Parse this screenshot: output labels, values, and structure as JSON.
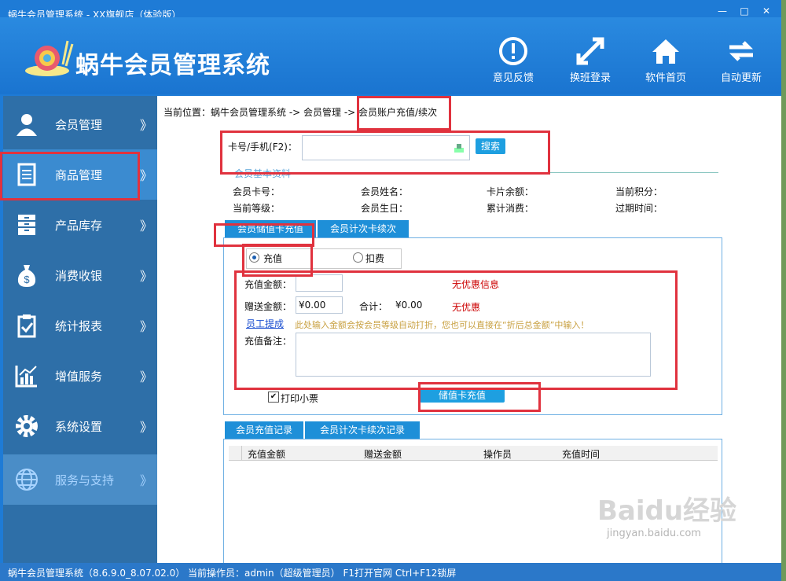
{
  "window": {
    "title": "蜗牛会员管理系统 - XX旗舰店（体验版）",
    "controls": [
      "—",
      "□",
      "✕"
    ]
  },
  "header": {
    "app_title": "蜗牛会员管理系统",
    "buttons": [
      {
        "label": "意见反馈",
        "icon": "exclamation-circle-icon"
      },
      {
        "label": "换班登录",
        "icon": "expand-arrows-icon"
      },
      {
        "label": "软件首页",
        "icon": "home-icon"
      },
      {
        "label": "自动更新",
        "icon": "refresh-arrows-icon"
      }
    ]
  },
  "sidebar": {
    "items": [
      {
        "label": "会员管理",
        "icon": "user-icon",
        "chevron": "》"
      },
      {
        "label": "商品管理",
        "icon": "document-icon",
        "chevron": "》"
      },
      {
        "label": "产品库存",
        "icon": "cabinet-icon",
        "chevron": "》"
      },
      {
        "label": "消费收银",
        "icon": "money-bag-icon",
        "chevron": "》"
      },
      {
        "label": "统计报表",
        "icon": "clipboard-check-icon",
        "chevron": "》"
      },
      {
        "label": "增值服务",
        "icon": "bar-chart-icon",
        "chevron": "》"
      },
      {
        "label": "系统设置",
        "icon": "gear-icon",
        "chevron": "》"
      },
      {
        "label": "服务与支持",
        "icon": "globe-icon",
        "chevron": "》"
      }
    ]
  },
  "content": {
    "breadcrumb_prefix": "当前位置：蜗牛会员管理系统 -> 会员管理 ->",
    "breadcrumb_current": "会员账户充值/续次",
    "search": {
      "label": "卡号/手机(F2)：",
      "value": "",
      "button": "搜索"
    },
    "member_info_title": "会员基本资料",
    "member_info": {
      "card_no": "会员卡号：",
      "name": "会员姓名：",
      "balance": "卡片余额：",
      "points": "当前积分：",
      "level": "当前等级：",
      "birthday": "会员生日：",
      "total_spend": "累计消费：",
      "expire": "过期时间："
    },
    "tabs": [
      "会员储值卡充值",
      "会员计次卡续次"
    ],
    "mode": {
      "recharge": "充值",
      "deduct": "扣费"
    },
    "form": {
      "amount_label": "充值金额：",
      "amount_value": "",
      "discount_info": "无优惠信息",
      "bonus_label": "赠送金额：",
      "bonus_value": "¥0.00",
      "total_label": "合计：",
      "total_value": "¥0.00",
      "no_discount": "无优惠",
      "staff_link": "员工提成",
      "hint": "此处输入金额会按会员等级自动打折，您也可以直接在“折后总金额”中输入！",
      "note_label": "充值备注：",
      "note_value": ""
    },
    "print_receipt": "打印小票",
    "submit_button": "储值卡充值",
    "record_tabs": [
      "会员充值记录",
      "会员计次卡续次记录"
    ],
    "record_columns": [
      "充值金额",
      "赠送金额",
      "操作员",
      "充值时间"
    ]
  },
  "statusbar": {
    "text": "蜗牛会员管理系统（8.6.9.0_8.07.02.0） 当前操作员：admin（超级管理员） F1打开官网 Ctrl+F12锁屏"
  },
  "watermark": {
    "brand": "Baidu经验",
    "url": "jingyan.baidu.com"
  },
  "colors": {
    "accent": "#1e8fd8",
    "sidebar": "#2e6fa8",
    "highlight": "#e0323e",
    "warning_text": "#cc0000",
    "hint_text": "#c8a040"
  }
}
